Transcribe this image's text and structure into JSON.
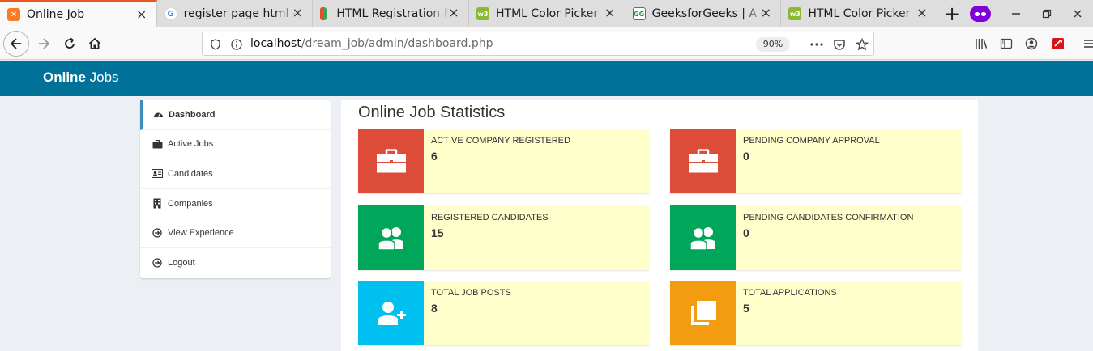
{
  "browser": {
    "tabs": [
      {
        "title": "Online Job",
        "favicon": "xampp-icon",
        "favicon_color": "#fb7a24",
        "active": true
      },
      {
        "title": "register page html - G",
        "favicon": "google-icon",
        "favicon_color": "#4285f4",
        "active": false
      },
      {
        "title": "HTML Registration F",
        "favicon": "codepen-icon",
        "favicon_color": "#e44d26",
        "active": false
      },
      {
        "title": "HTML Color Picker",
        "favicon": "w3schools-icon",
        "favicon_color": "#8ab832",
        "active": false
      },
      {
        "title": "GeeksforGeeks | A co",
        "favicon": "geeksforgeeks-icon",
        "favicon_color": "#2f8d46",
        "active": false
      },
      {
        "title": "HTML Color Picker",
        "favicon": "w3schools-icon",
        "favicon_color": "#8ab832",
        "active": false
      }
    ],
    "url_host": "localhost",
    "url_path": "/dream_job/admin/dashboard.php",
    "zoom": "90%"
  },
  "header": {
    "brand_bold": "Online",
    "brand_rest": "Jobs",
    "color": "#00729a"
  },
  "sidebar": {
    "items": [
      {
        "label": "Dashboard",
        "icon": "dashboard-icon",
        "active": true
      },
      {
        "label": "Active Jobs",
        "icon": "briefcase-icon",
        "active": false
      },
      {
        "label": "Candidates",
        "icon": "id-card-icon",
        "active": false
      },
      {
        "label": "Companies",
        "icon": "building-icon",
        "active": false
      },
      {
        "label": "View Experience",
        "icon": "arrow-circle-icon",
        "active": false
      },
      {
        "label": "Logout",
        "icon": "arrow-circle-icon",
        "active": false
      }
    ]
  },
  "main": {
    "title": "Online Job Statistics",
    "stats": [
      {
        "label": "ACTIVE COMPANY REGISTERED",
        "value": "6",
        "icon": "briefcase-icon",
        "color": "#dd4b39"
      },
      {
        "label": "PENDING COMPANY APPROVAL",
        "value": "0",
        "icon": "briefcase-icon",
        "color": "#dd4b39"
      },
      {
        "label": "REGISTERED CANDIDATES",
        "value": "15",
        "icon": "users-icon",
        "color": "#00a65a"
      },
      {
        "label": "PENDING CANDIDATES CONFIRMATION",
        "value": "0",
        "icon": "users-icon",
        "color": "#00a65a"
      },
      {
        "label": "TOTAL JOB POSTS",
        "value": "8",
        "icon": "user-plus-icon",
        "color": "#00c0ef"
      },
      {
        "label": "TOTAL APPLICATIONS",
        "value": "5",
        "icon": "copy-icon",
        "color": "#f39c12"
      }
    ]
  }
}
